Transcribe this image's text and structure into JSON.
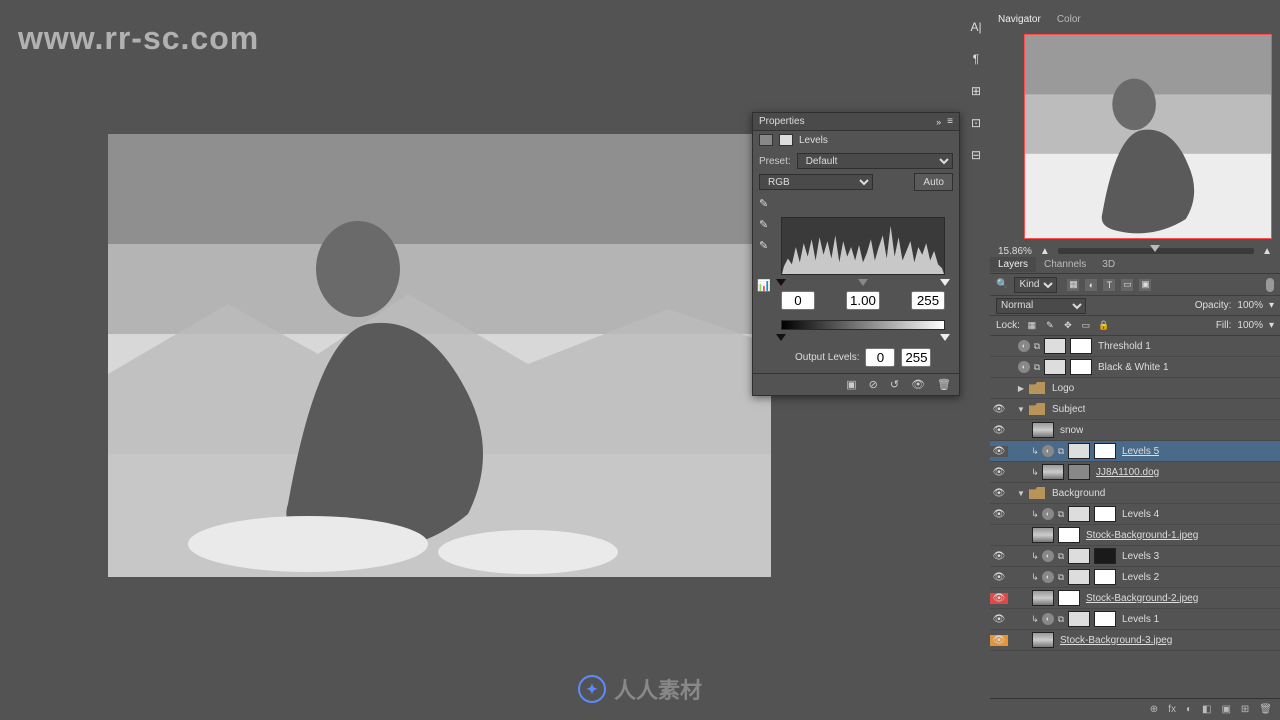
{
  "watermark": "www.rr-sc.com",
  "footer_brand": "人人素材",
  "tool_strip": {
    "items": [
      "A|",
      "¶",
      "⊞",
      "⊡",
      "⊟"
    ]
  },
  "navigator": {
    "tabs": [
      "Navigator",
      "Color"
    ],
    "active": 0,
    "zoom": "15.86%"
  },
  "layers_panel": {
    "tabs": [
      "Layers",
      "Channels",
      "3D"
    ],
    "active": 0,
    "filter_kind": "Kind",
    "blend_mode": "Normal",
    "opacity_label": "Opacity:",
    "opacity_value": "100%",
    "lock_label": "Lock:",
    "fill_label": "Fill:",
    "fill_value": "100%",
    "layers": [
      {
        "eye": false,
        "hl": "green",
        "indent": 0,
        "icons": [
          "fx",
          "link"
        ],
        "thumb": "light",
        "mask": "white",
        "name": "Threshold 1"
      },
      {
        "eye": false,
        "hl": "green",
        "indent": 0,
        "icons": [
          "fx",
          "link"
        ],
        "thumb": "light",
        "mask": "white",
        "name": "Black & White 1"
      },
      {
        "eye": false,
        "hl": "",
        "indent": 0,
        "group": true,
        "open": false,
        "name": "Logo"
      },
      {
        "eye": true,
        "hl": "",
        "indent": 0,
        "group": true,
        "open": true,
        "name": "Subject"
      },
      {
        "eye": true,
        "hl": "",
        "indent": 1,
        "thumb": "img",
        "name": "snow"
      },
      {
        "eye": true,
        "hl": "",
        "indent": 1,
        "clip": true,
        "icons": [
          "fx",
          "link"
        ],
        "thumb": "light",
        "mask": "white",
        "name": "Levels 5",
        "selected": true
      },
      {
        "eye": true,
        "hl": "",
        "indent": 1,
        "clip": true,
        "thumb": "img",
        "mask": "grey",
        "name": "JJ8A1100.dog",
        "underline": true
      },
      {
        "eye": true,
        "hl": "",
        "indent": 0,
        "group": true,
        "open": true,
        "name": "Background"
      },
      {
        "eye": true,
        "hl": "",
        "indent": 1,
        "clip": true,
        "icons": [
          "fx",
          "link"
        ],
        "thumb": "light",
        "mask": "white",
        "name": "Levels 4"
      },
      {
        "eye": false,
        "hl": "",
        "indent": 1,
        "thumb": "img",
        "mask": "white",
        "name": "Stock-Background-1.jpeg",
        "underline": true
      },
      {
        "eye": true,
        "hl": "",
        "indent": 1,
        "clip": true,
        "icons": [
          "fx",
          "link"
        ],
        "thumb": "light",
        "mask": "dark",
        "name": "Levels 3"
      },
      {
        "eye": true,
        "hl": "",
        "indent": 1,
        "clip": true,
        "icons": [
          "fx",
          "link"
        ],
        "thumb": "light",
        "mask": "white",
        "name": "Levels 2"
      },
      {
        "eye": true,
        "hl": "red",
        "indent": 1,
        "thumb": "img",
        "mask": "white",
        "name": "Stock-Background-2.jpeg",
        "underline": true
      },
      {
        "eye": true,
        "hl": "",
        "indent": 1,
        "clip": true,
        "icons": [
          "fx",
          "link"
        ],
        "thumb": "light",
        "mask": "white",
        "name": "Levels 1"
      },
      {
        "eye": true,
        "hl": "orange",
        "indent": 1,
        "thumb": "img",
        "name": "Stock-Background-3.jpeg",
        "underline": true
      }
    ],
    "footer_icons": [
      "⊕",
      "fx",
      "◐",
      "◧",
      "▣",
      "⊞",
      "🗑"
    ]
  },
  "properties": {
    "title": "Properties",
    "adjustment": "Levels",
    "preset_label": "Preset:",
    "preset_value": "Default",
    "channel_value": "RGB",
    "auto_label": "Auto",
    "input_black": "0",
    "input_mid": "1.00",
    "input_white": "255",
    "output_label": "Output Levels:",
    "output_black": "0",
    "output_white": "255",
    "footer_icons": [
      "▣",
      "⊘",
      "↺",
      "👁",
      "🗑"
    ]
  }
}
